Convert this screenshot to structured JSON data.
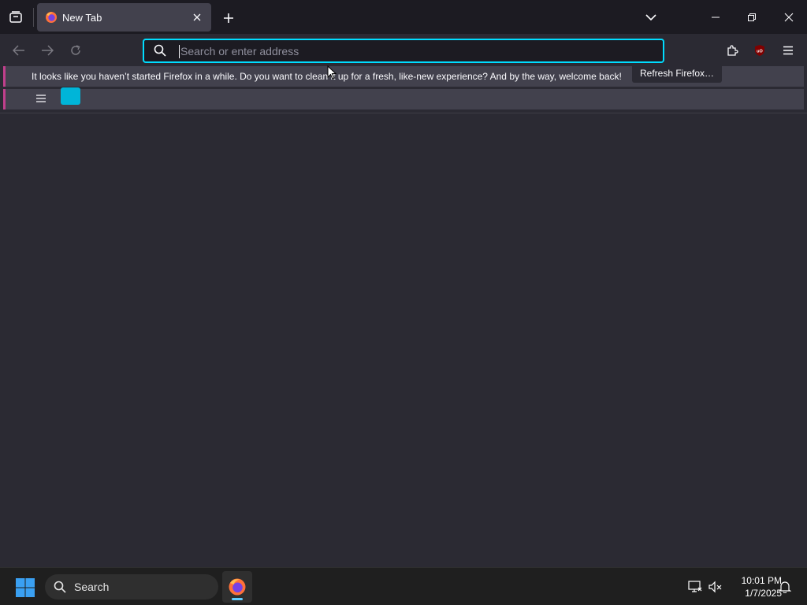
{
  "tabs": [
    {
      "title": "New Tab",
      "active": true
    }
  ],
  "urlbar": {
    "placeholder": "Search or enter address",
    "value": ""
  },
  "notification": {
    "message": "It looks like you haven’t started Firefox in a while. Do you want to clean it up for a fresh, like-new experience? And by the way, welcome back!",
    "button_label": "Refresh Firefox…"
  },
  "taskbar": {
    "search_label": "Search",
    "time": "10:01 PM",
    "date": "1/7/2025"
  },
  "colors": {
    "accent_focus": "#00ddff",
    "notification_stripe": "#c13f8c",
    "bookmark_tile": "#00b5d8",
    "ublock_badge": "#800000"
  },
  "icons": {
    "tab_list": "tab-list-icon",
    "new_tab": "plus-icon",
    "all_tabs": "chevron-down-icon",
    "back": "back-arrow-icon",
    "forward": "forward-arrow-icon",
    "reload": "reload-icon",
    "search": "search-icon",
    "extensions": "puzzle-icon",
    "ublock": "ublock-origin-icon",
    "app_menu": "hamburger-icon"
  }
}
